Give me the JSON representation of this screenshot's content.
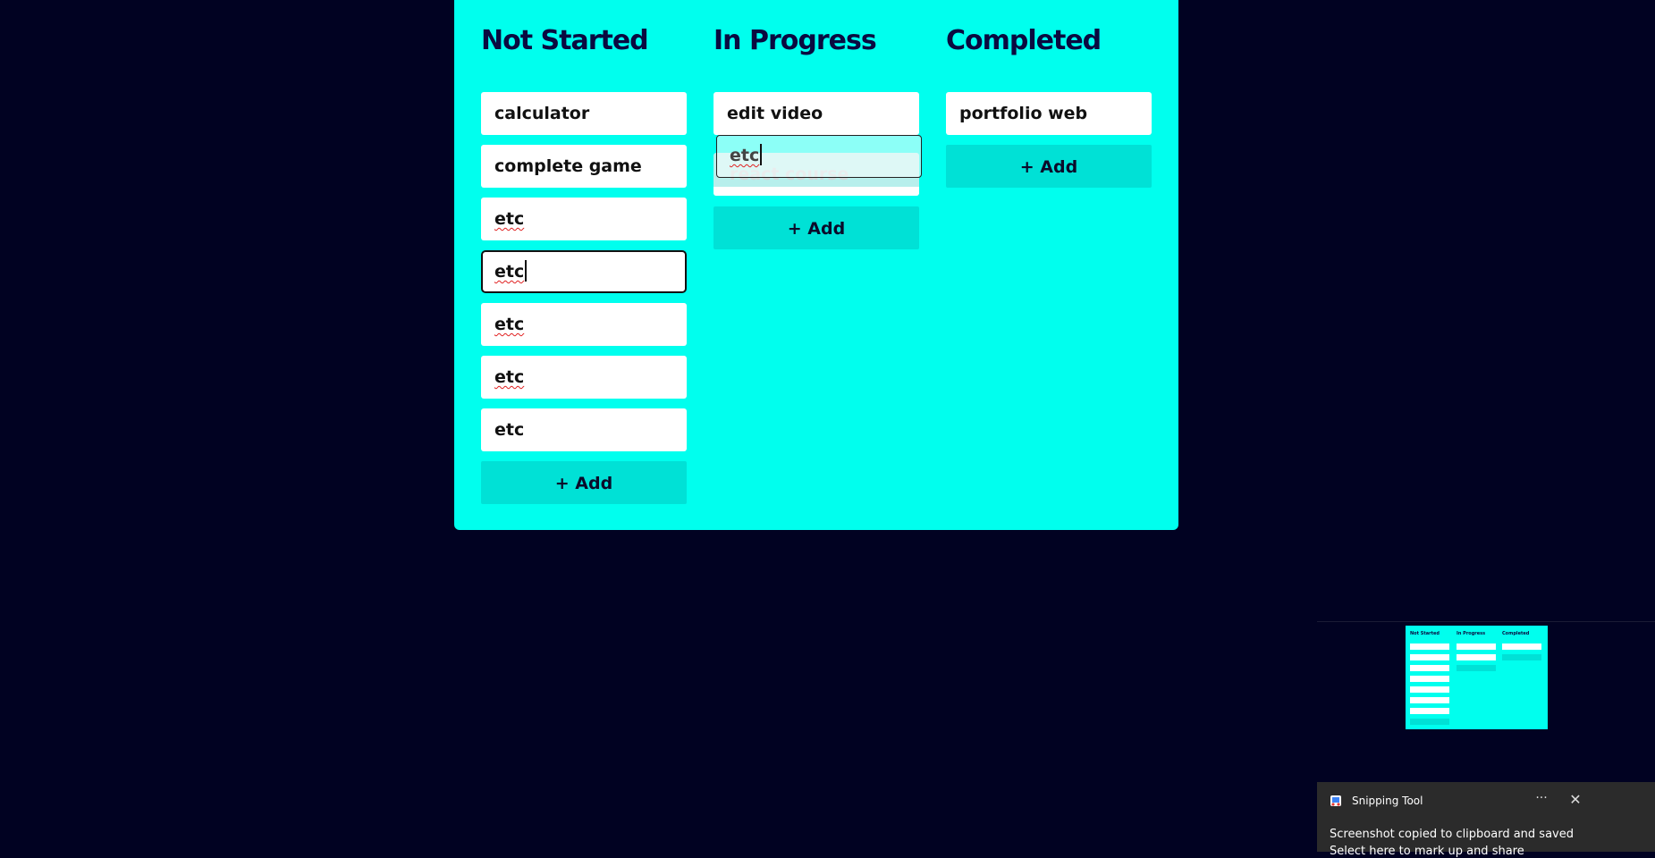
{
  "board": {
    "columns": [
      {
        "title": "Not Started",
        "cards": [
          "calculator",
          "complete game",
          "etc",
          "etc",
          "etc",
          "etc",
          "etc"
        ],
        "add_label": "+ Add"
      },
      {
        "title": "In Progress",
        "cards": [
          "edit video"
        ],
        "drag_ghost": "etc",
        "drop_placeholder": "react course",
        "add_label": "+ Add"
      },
      {
        "title": "Completed",
        "cards": [
          "portfolio web"
        ],
        "add_label": "+ Add"
      }
    ],
    "colors": {
      "background": "#010222",
      "board": "#00ffee",
      "add_button": "#00e1d6",
      "title": "#0a0a40"
    }
  },
  "snipping_tool": {
    "app_name": "Snipping Tool",
    "message": "Screenshot copied to clipboard and saved",
    "sub_message": "Select here to mark up and share",
    "more_icon": "more-horizontal-icon",
    "close_icon": "close-icon"
  }
}
